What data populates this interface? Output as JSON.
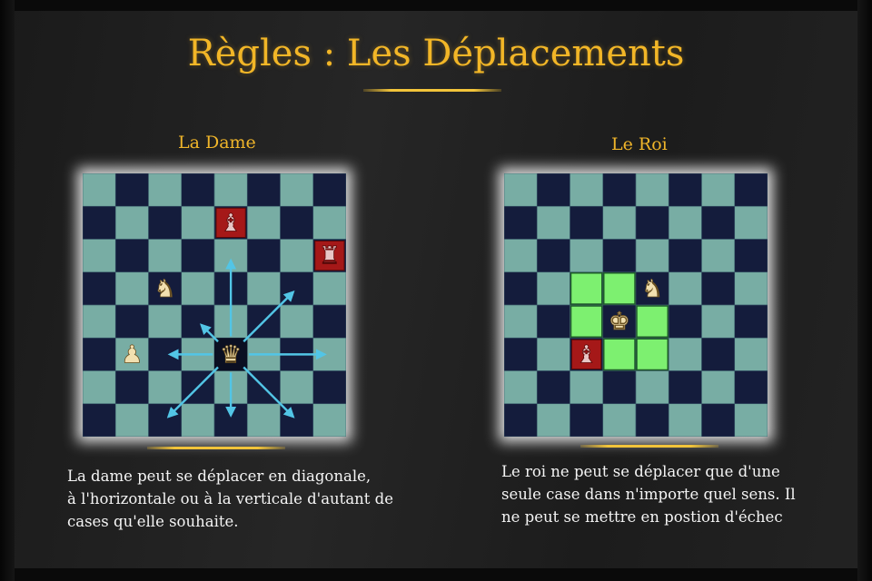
{
  "page": {
    "title": "Règles : Les Déplacements",
    "accent_color": "#f2b627"
  },
  "board_colors": {
    "light": "#78ada4",
    "dark": "#141c3c",
    "highlight": "#7df070",
    "arrow": "#52c5e6"
  },
  "queen_panel": {
    "heading": "La Dame",
    "description_lines": [
      "La dame peut se déplacer en diagonale,",
      "à l'horizontale ou à la verticale d'autant de",
      "cases qu'elle souhaite."
    ],
    "pieces": [
      {
        "name": "enemy-bishop",
        "glyph": "♝",
        "color": "red",
        "col": 4,
        "row": 1
      },
      {
        "name": "enemy-rook",
        "glyph": "♜",
        "color": "red",
        "col": 7,
        "row": 2
      },
      {
        "name": "own-knight",
        "glyph": "♞",
        "color": "cream",
        "col": 2,
        "row": 3
      },
      {
        "name": "own-pawn",
        "glyph": "♟",
        "color": "cream",
        "col": 1,
        "row": 5
      },
      {
        "name": "queen",
        "glyph": "♛",
        "color": "cream",
        "col": 4,
        "row": 5,
        "square": "dark"
      }
    ],
    "arrows": [
      {
        "name": "arrow-up",
        "dc": 0,
        "dr": -3
      },
      {
        "name": "arrow-down",
        "dc": 0,
        "dr": 2
      },
      {
        "name": "arrow-left",
        "dc": -2,
        "dr": 0
      },
      {
        "name": "arrow-right",
        "dc": 3,
        "dr": 0
      },
      {
        "name": "arrow-up-left",
        "dc": -1,
        "dr": -1
      },
      {
        "name": "arrow-up-right",
        "dc": 2,
        "dr": -2
      },
      {
        "name": "arrow-down-left",
        "dc": -2,
        "dr": 2
      },
      {
        "name": "arrow-down-right",
        "dc": 2,
        "dr": 2
      }
    ]
  },
  "king_panel": {
    "heading": "Le Roi",
    "description_lines": [
      "Le roi ne peut se déplacer que d'une",
      "seule case dans n'importe quel sens. Il",
      "ne peut se mettre en postion d'échec"
    ],
    "highlights": [
      {
        "col": 2,
        "row": 3
      },
      {
        "col": 3,
        "row": 3
      },
      {
        "col": 2,
        "row": 4
      },
      {
        "col": 4,
        "row": 4
      },
      {
        "col": 3,
        "row": 5
      },
      {
        "col": 4,
        "row": 5
      }
    ],
    "pieces": [
      {
        "name": "own-knight",
        "glyph": "♞",
        "color": "cream",
        "col": 4,
        "row": 3
      },
      {
        "name": "king",
        "glyph": "♚",
        "color": "cream",
        "col": 3,
        "row": 4
      },
      {
        "name": "enemy-bishop",
        "glyph": "♝",
        "color": "red",
        "col": 2,
        "row": 5
      }
    ]
  }
}
